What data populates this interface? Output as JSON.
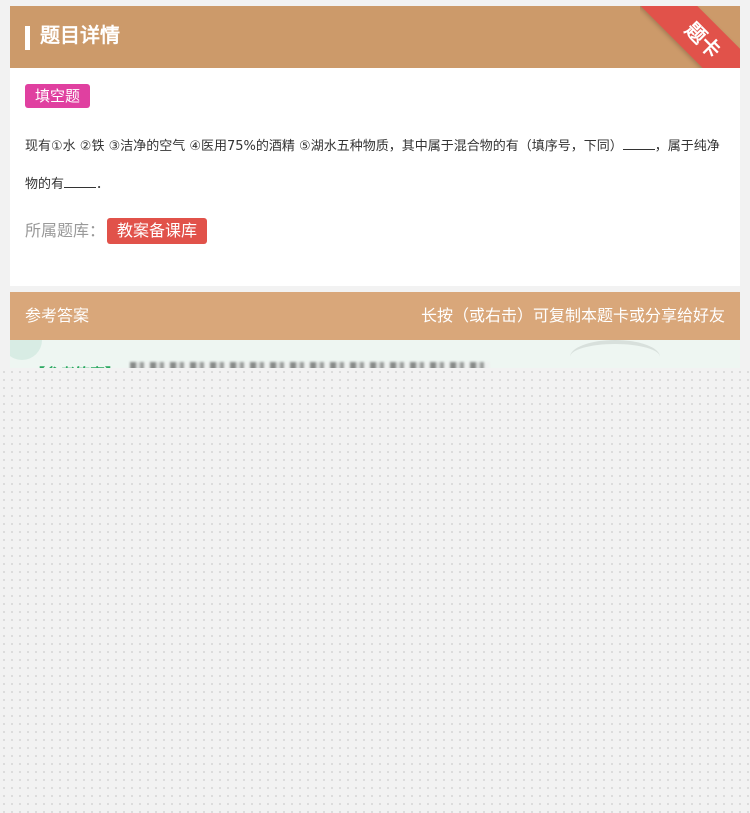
{
  "header": {
    "title": "题目详情",
    "ribbon": "题卡"
  },
  "question": {
    "type_tag": "填空题",
    "text_part1": "现有①水 ②铁 ③洁净的空气 ④医用75%的酒精 ⑤湖水五种物质，其中属于混合物的有（填序号，下同）",
    "text_part2": "，属于纯净物的有",
    "text_end": "．",
    "bank_label": "所属题库：",
    "bank_tag": "教案备课库"
  },
  "answer": {
    "header_left": "参考答案",
    "header_right": "长按（或右击）可复制本题卡或分享给好友",
    "label": "【参考答案】"
  },
  "colors": {
    "header_bg": "#cc9a6a",
    "ribbon": "#e1524a",
    "type_tag": "#e040a0",
    "bank_tag": "#e1524a",
    "answer_header_bg": "#d9a77a",
    "answer_label": "#2aa860"
  }
}
